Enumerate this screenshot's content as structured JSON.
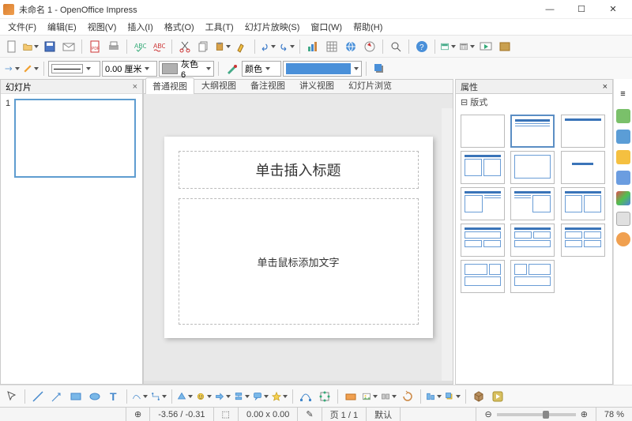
{
  "title": "未命名 1 - OpenOffice Impress",
  "menu": [
    "文件(F)",
    "编辑(E)",
    "视图(V)",
    "插入(I)",
    "格式(O)",
    "工具(T)",
    "幻灯片放映(S)",
    "窗口(W)",
    "帮助(H)"
  ],
  "toolbar2": {
    "width_value": "0.00 厘米",
    "color_name": "灰色 6",
    "color_label": "颜色"
  },
  "slide_panel": {
    "title": "幻灯片",
    "thumb_num": "1"
  },
  "view_tabs": [
    "普通视图",
    "大纲视图",
    "备注视图",
    "讲义视图",
    "幻灯片浏览"
  ],
  "slide": {
    "title_ph": "单击插入标题",
    "body_ph": "单击鼠标添加文字"
  },
  "props": {
    "title": "属性",
    "section": "版式"
  },
  "status": {
    "coords": "-3.56 / -0.31",
    "size": "0.00 x 0.00",
    "page": "页 1 / 1",
    "mode": "默认",
    "zoom": "78 %"
  }
}
